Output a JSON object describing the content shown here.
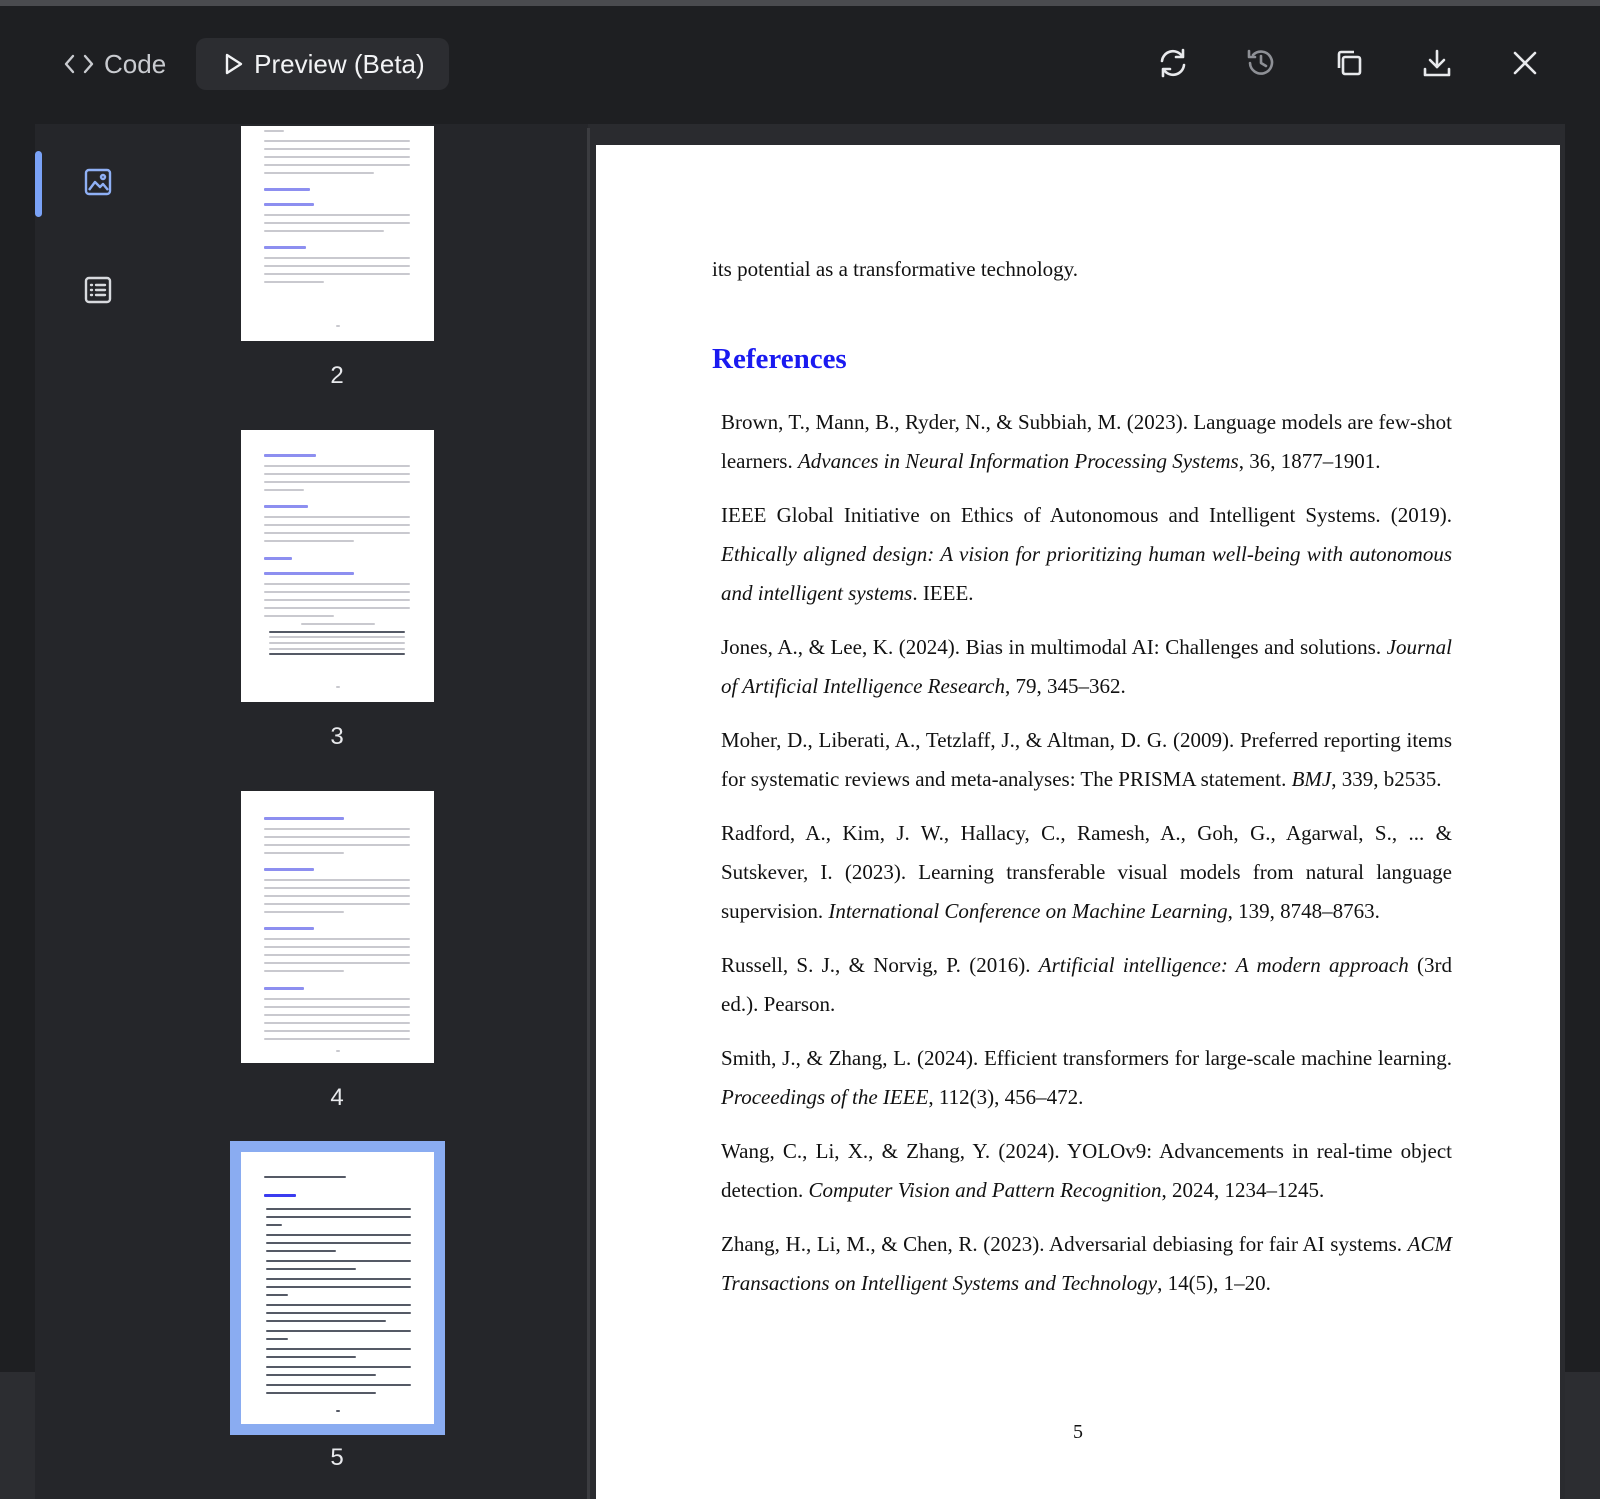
{
  "tabs": {
    "code_label": "Code",
    "preview_label": "Preview (Beta)"
  },
  "actions": [
    {
      "name": "refresh-icon"
    },
    {
      "name": "history-icon"
    },
    {
      "name": "copy-icon"
    },
    {
      "name": "download-icon"
    },
    {
      "name": "close-icon"
    }
  ],
  "rail": {
    "items": [
      {
        "name": "thumbnails-view-icon",
        "active": true
      },
      {
        "name": "outline-view-icon",
        "active": false
      }
    ],
    "accent": "#7aa2f7"
  },
  "thumbnails": {
    "pages": [
      {
        "label": "2",
        "selected": false
      },
      {
        "label": "3",
        "selected": false
      },
      {
        "label": "4",
        "selected": false
      },
      {
        "label": "5",
        "selected": true
      }
    ],
    "selection_color": "#8aacf1"
  },
  "document": {
    "intro": "its potential as a transformative technology.",
    "heading": "References",
    "heading_color": "#1a1af0",
    "page_number": "5",
    "references": [
      {
        "before": "Brown, T., Mann, B., Ryder, N., & Subbiah, M. (2023). Language models are few-shot learners. ",
        "italic": "Advances in Neural Information Processing Systems",
        "after": ", 36, 1877–1901."
      },
      {
        "before": "IEEE Global Initiative on Ethics of Autonomous and Intelligent Systems. (2019). ",
        "italic": "Ethically aligned design: A vision for prioritizing human well-being with autonomous and intelligent systems",
        "after": ". IEEE."
      },
      {
        "before": "Jones, A., & Lee, K. (2024). Bias in multimodal AI: Challenges and solutions. ",
        "italic": "Journal of Artificial Intelligence Research",
        "after": ", 79, 345–362."
      },
      {
        "before": "Moher, D., Liberati, A., Tetzlaff, J., & Altman, D. G. (2009). Preferred reporting items for systematic reviews and meta-analyses: The PRISMA statement. ",
        "italic": "BMJ",
        "after": ", 339, b2535."
      },
      {
        "before": "Radford, A., Kim, J. W., Hallacy, C., Ramesh, A., Goh, G., Agarwal, S., ... & Sutskever, I. (2023). Learning transferable visual models from natural language supervision. ",
        "italic": "International Conference on Machine Learning",
        "after": ", 139, 8748–8763."
      },
      {
        "before": "Russell, S. J., & Norvig, P. (2016). ",
        "italic": "Artificial intelligence: A modern approach",
        "after": " (3rd ed.). Pearson."
      },
      {
        "before": "Smith, J., & Zhang, L. (2024). Efficient transformers for large-scale machine learning. ",
        "italic": "Proceedings of the IEEE",
        "after": ", 112(3), 456–472."
      },
      {
        "before": "Wang, C., Li, X., & Zhang, Y. (2024). YOLOv9: Advancements in real-time object detection. ",
        "italic": "Computer Vision and Pattern Recognition",
        "after": ", 2024, 1234–1245."
      },
      {
        "before": "Zhang, H., Li, M., & Chen, R. (2023). Adversarial debiasing for fair AI systems. ",
        "italic": "ACM Transactions on Intelligent Systems and Technology",
        "after": ", 14(5), 1–20."
      }
    ]
  }
}
